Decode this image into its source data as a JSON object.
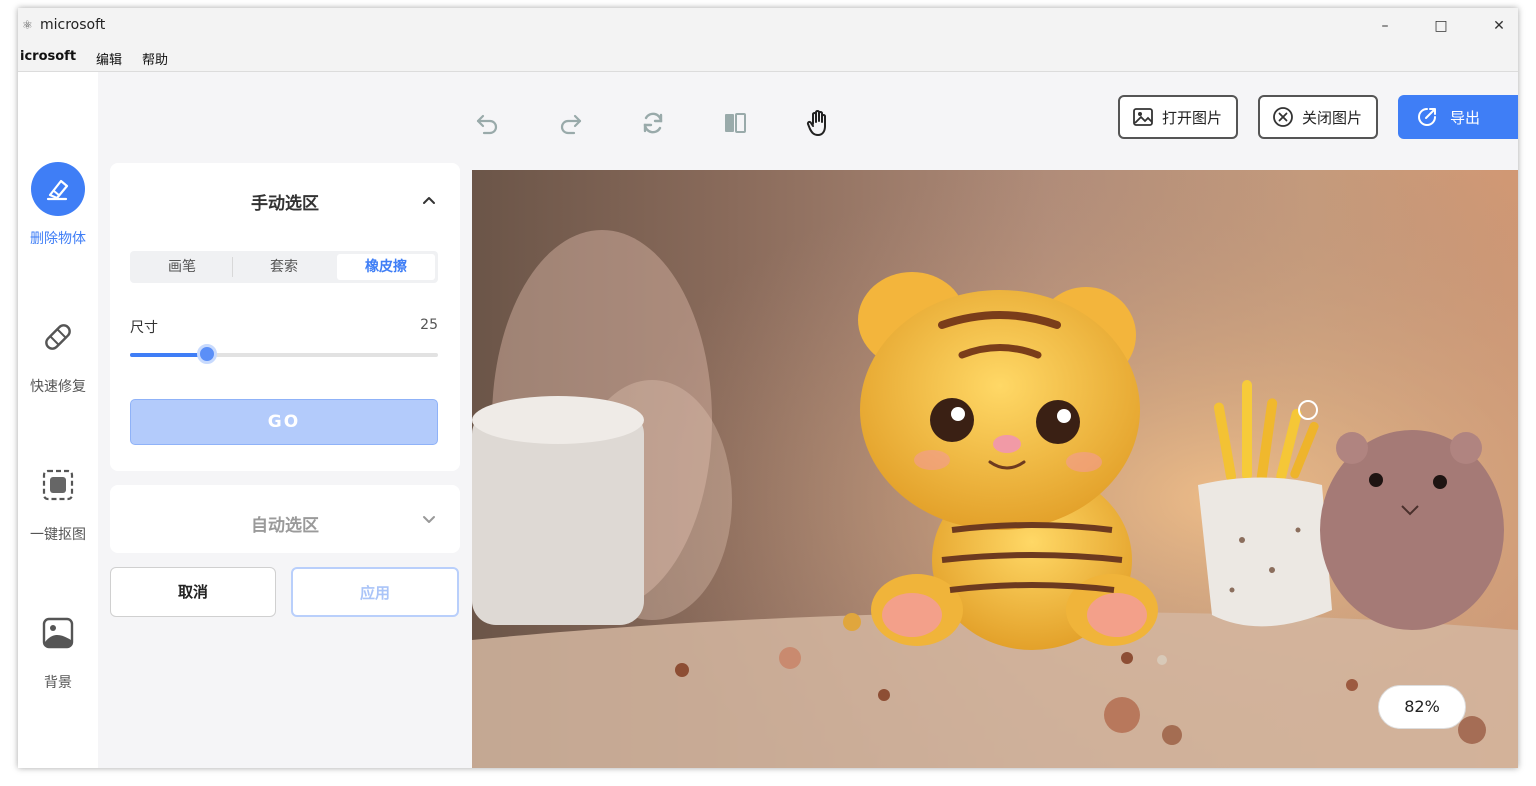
{
  "window": {
    "title": "microsoft"
  },
  "menubar": {
    "items": [
      "icrosoft",
      "编辑",
      "帮助"
    ]
  },
  "rail": {
    "items": [
      {
        "label": "删除物体",
        "icon": "eraser-icon",
        "active": true
      },
      {
        "label": "快速修复",
        "icon": "bandage-icon",
        "active": false
      },
      {
        "label": "一键抠图",
        "icon": "cutout-icon",
        "active": false
      },
      {
        "label": "背景",
        "icon": "background-image-icon",
        "active": false
      }
    ]
  },
  "toolbar": {
    "open_image": "打开图片",
    "close_image": "关闭图片",
    "export": "导出"
  },
  "manual": {
    "title": "手动选区",
    "tabs": [
      "画笔",
      "套索",
      "橡皮擦"
    ],
    "active_tab": "橡皮擦",
    "size_label": "尺寸",
    "size_value": "25",
    "size_fraction": 0.25,
    "go_label": "GO"
  },
  "auto": {
    "title": "自动选区"
  },
  "actions": {
    "cancel": "取消",
    "apply": "应用"
  },
  "canvas": {
    "zoom": "82%"
  },
  "colors": {
    "accent": "#3f7ef6"
  }
}
